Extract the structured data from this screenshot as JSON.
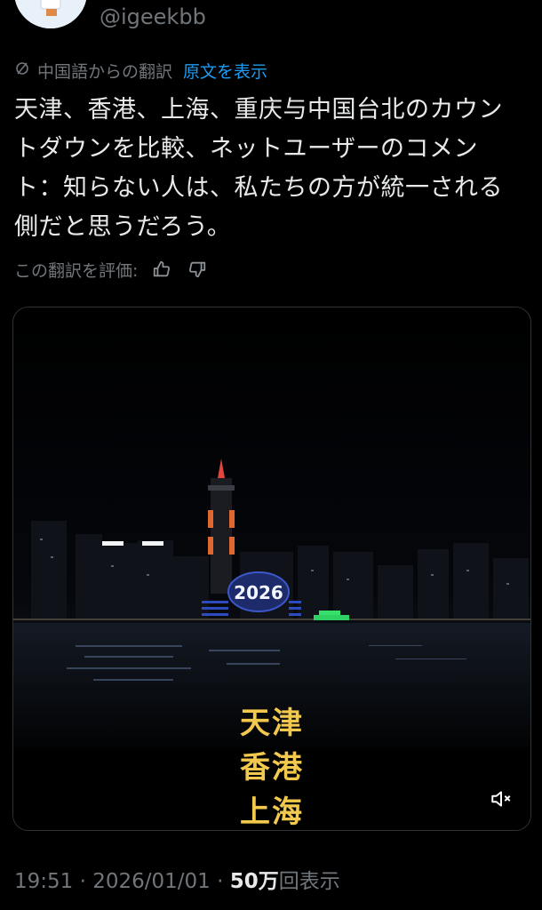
{
  "profile": {
    "handle": "@igeekbb"
  },
  "translation": {
    "source_label": "中国語からの翻訳",
    "show_original": "原文を表示"
  },
  "tweet": {
    "text": "天津、香港、上海、重庆与中国台北のカウントダウンを比較、ネットユーザーのコメント：知らない人は、私たちの方が統一される側だと思うだろう。"
  },
  "rating": {
    "label": "この翻訳を評価:",
    "thumbs_up_icon": "thumbs-up-icon",
    "thumbs_down_icon": "thumbs-down-icon"
  },
  "video": {
    "building_display": "2026",
    "captions": [
      "天津",
      "香港",
      "上海"
    ],
    "caption_color": "#f2c94c",
    "mute_icon": "speaker-muted-icon"
  },
  "meta": {
    "time": "19:51",
    "sep1": "·",
    "date": "2026/01/01",
    "sep2": "·",
    "views_count": "50万",
    "views_label": "回表示"
  },
  "colors": {
    "background": "#000000",
    "text": "#e7e9ea",
    "secondary": "#71767b",
    "link": "#1d9bf0"
  }
}
